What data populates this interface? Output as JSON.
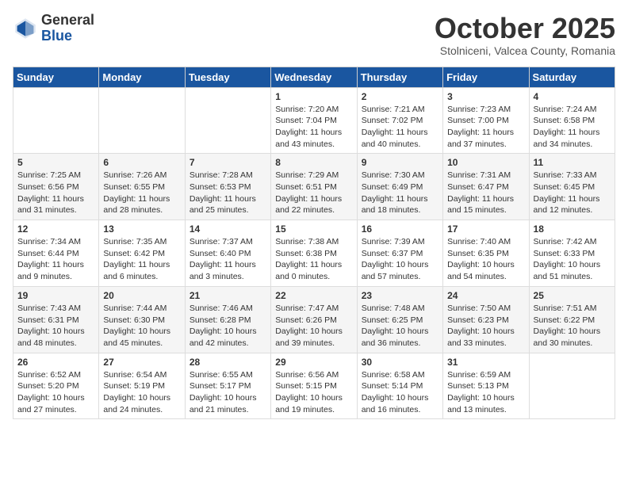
{
  "header": {
    "logo_general": "General",
    "logo_blue": "Blue",
    "month_title": "October 2025",
    "subtitle": "Stolniceni, Valcea County, Romania"
  },
  "weekdays": [
    "Sunday",
    "Monday",
    "Tuesday",
    "Wednesday",
    "Thursday",
    "Friday",
    "Saturday"
  ],
  "weeks": [
    [
      {
        "day": "",
        "info": ""
      },
      {
        "day": "",
        "info": ""
      },
      {
        "day": "",
        "info": ""
      },
      {
        "day": "1",
        "info": "Sunrise: 7:20 AM\nSunset: 7:04 PM\nDaylight: 11 hours and 43 minutes."
      },
      {
        "day": "2",
        "info": "Sunrise: 7:21 AM\nSunset: 7:02 PM\nDaylight: 11 hours and 40 minutes."
      },
      {
        "day": "3",
        "info": "Sunrise: 7:23 AM\nSunset: 7:00 PM\nDaylight: 11 hours and 37 minutes."
      },
      {
        "day": "4",
        "info": "Sunrise: 7:24 AM\nSunset: 6:58 PM\nDaylight: 11 hours and 34 minutes."
      }
    ],
    [
      {
        "day": "5",
        "info": "Sunrise: 7:25 AM\nSunset: 6:56 PM\nDaylight: 11 hours and 31 minutes."
      },
      {
        "day": "6",
        "info": "Sunrise: 7:26 AM\nSunset: 6:55 PM\nDaylight: 11 hours and 28 minutes."
      },
      {
        "day": "7",
        "info": "Sunrise: 7:28 AM\nSunset: 6:53 PM\nDaylight: 11 hours and 25 minutes."
      },
      {
        "day": "8",
        "info": "Sunrise: 7:29 AM\nSunset: 6:51 PM\nDaylight: 11 hours and 22 minutes."
      },
      {
        "day": "9",
        "info": "Sunrise: 7:30 AM\nSunset: 6:49 PM\nDaylight: 11 hours and 18 minutes."
      },
      {
        "day": "10",
        "info": "Sunrise: 7:31 AM\nSunset: 6:47 PM\nDaylight: 11 hours and 15 minutes."
      },
      {
        "day": "11",
        "info": "Sunrise: 7:33 AM\nSunset: 6:45 PM\nDaylight: 11 hours and 12 minutes."
      }
    ],
    [
      {
        "day": "12",
        "info": "Sunrise: 7:34 AM\nSunset: 6:44 PM\nDaylight: 11 hours and 9 minutes."
      },
      {
        "day": "13",
        "info": "Sunrise: 7:35 AM\nSunset: 6:42 PM\nDaylight: 11 hours and 6 minutes."
      },
      {
        "day": "14",
        "info": "Sunrise: 7:37 AM\nSunset: 6:40 PM\nDaylight: 11 hours and 3 minutes."
      },
      {
        "day": "15",
        "info": "Sunrise: 7:38 AM\nSunset: 6:38 PM\nDaylight: 11 hours and 0 minutes."
      },
      {
        "day": "16",
        "info": "Sunrise: 7:39 AM\nSunset: 6:37 PM\nDaylight: 10 hours and 57 minutes."
      },
      {
        "day": "17",
        "info": "Sunrise: 7:40 AM\nSunset: 6:35 PM\nDaylight: 10 hours and 54 minutes."
      },
      {
        "day": "18",
        "info": "Sunrise: 7:42 AM\nSunset: 6:33 PM\nDaylight: 10 hours and 51 minutes."
      }
    ],
    [
      {
        "day": "19",
        "info": "Sunrise: 7:43 AM\nSunset: 6:31 PM\nDaylight: 10 hours and 48 minutes."
      },
      {
        "day": "20",
        "info": "Sunrise: 7:44 AM\nSunset: 6:30 PM\nDaylight: 10 hours and 45 minutes."
      },
      {
        "day": "21",
        "info": "Sunrise: 7:46 AM\nSunset: 6:28 PM\nDaylight: 10 hours and 42 minutes."
      },
      {
        "day": "22",
        "info": "Sunrise: 7:47 AM\nSunset: 6:26 PM\nDaylight: 10 hours and 39 minutes."
      },
      {
        "day": "23",
        "info": "Sunrise: 7:48 AM\nSunset: 6:25 PM\nDaylight: 10 hours and 36 minutes."
      },
      {
        "day": "24",
        "info": "Sunrise: 7:50 AM\nSunset: 6:23 PM\nDaylight: 10 hours and 33 minutes."
      },
      {
        "day": "25",
        "info": "Sunrise: 7:51 AM\nSunset: 6:22 PM\nDaylight: 10 hours and 30 minutes."
      }
    ],
    [
      {
        "day": "26",
        "info": "Sunrise: 6:52 AM\nSunset: 5:20 PM\nDaylight: 10 hours and 27 minutes."
      },
      {
        "day": "27",
        "info": "Sunrise: 6:54 AM\nSunset: 5:19 PM\nDaylight: 10 hours and 24 minutes."
      },
      {
        "day": "28",
        "info": "Sunrise: 6:55 AM\nSunset: 5:17 PM\nDaylight: 10 hours and 21 minutes."
      },
      {
        "day": "29",
        "info": "Sunrise: 6:56 AM\nSunset: 5:15 PM\nDaylight: 10 hours and 19 minutes."
      },
      {
        "day": "30",
        "info": "Sunrise: 6:58 AM\nSunset: 5:14 PM\nDaylight: 10 hours and 16 minutes."
      },
      {
        "day": "31",
        "info": "Sunrise: 6:59 AM\nSunset: 5:13 PM\nDaylight: 10 hours and 13 minutes."
      },
      {
        "day": "",
        "info": ""
      }
    ]
  ]
}
